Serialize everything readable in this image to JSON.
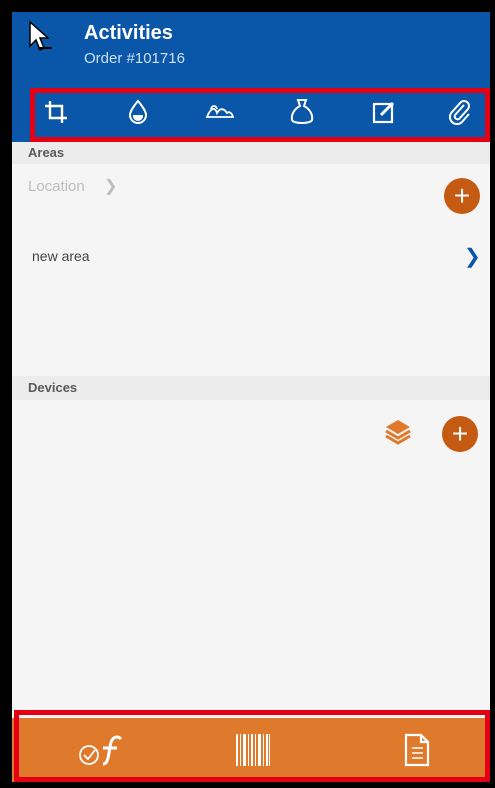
{
  "header": {
    "title": "Activities",
    "subtitle": "Order #101716"
  },
  "toolbar": {
    "icons": [
      "crop-icon",
      "drop-icon",
      "terrain-icon",
      "sack-icon",
      "edit-icon",
      "paperclip-icon"
    ]
  },
  "areas": {
    "heading": "Areas",
    "location_label": "Location",
    "rows": [
      {
        "label": "new area"
      }
    ]
  },
  "devices": {
    "heading": "Devices"
  },
  "colors": {
    "primary": "#0a56a8",
    "accent": "#c55a12",
    "bottom_bar": "#df7a2c",
    "highlight": "#e40012"
  },
  "bottom_bar": {
    "icons": [
      "check-formula-icon",
      "barcode-icon",
      "document-icon"
    ]
  }
}
